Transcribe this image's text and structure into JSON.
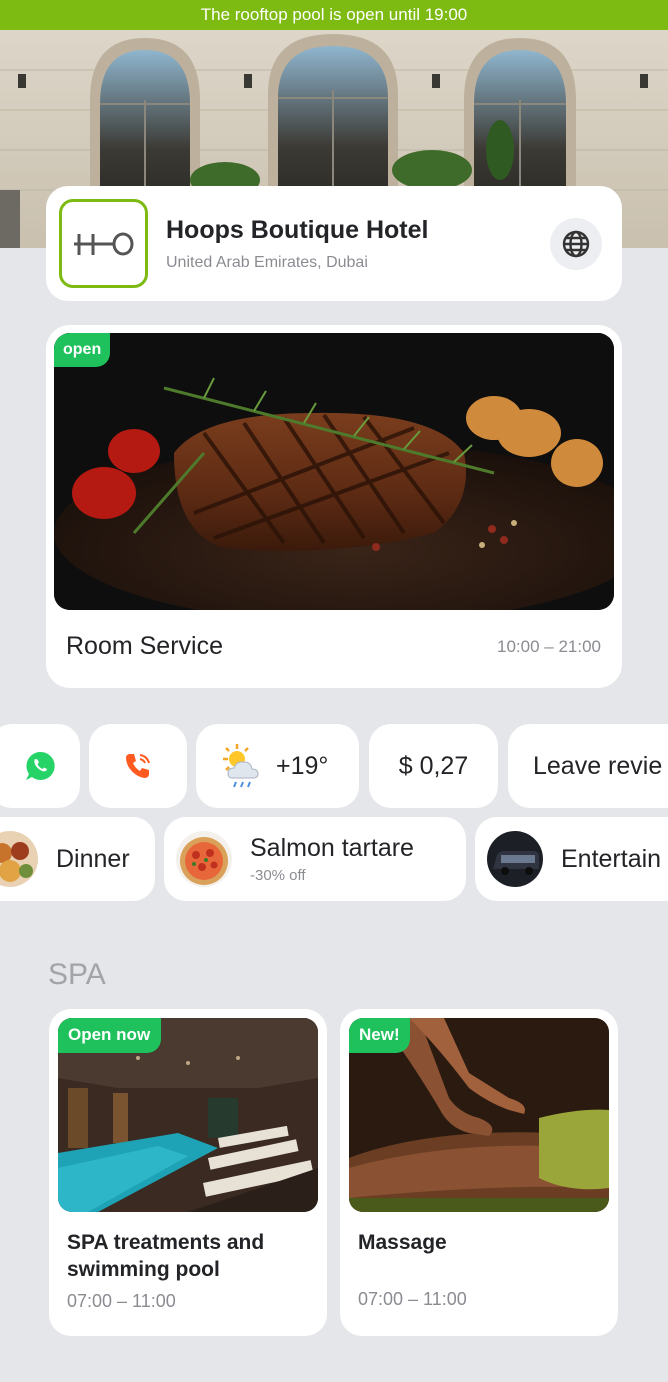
{
  "banner": {
    "text": "The rooftop pool is open until 19:00"
  },
  "hotel": {
    "logo_text": "H–O",
    "name": "Hoops Boutique Hotel",
    "location": "United Arab Emirates, Dubai"
  },
  "room_service": {
    "badge": "open",
    "title": "Room Service",
    "hours": "10:00 – 21:00"
  },
  "quick_actions": {
    "weather": "+19°",
    "rate": "$ 0,27",
    "review": "Leave revie"
  },
  "offers": [
    {
      "label": "Dinner"
    },
    {
      "label": "Salmon tartare",
      "sub": "-30% off"
    },
    {
      "label": "Entertain"
    }
  ],
  "spa": {
    "title": "SPA",
    "cards": [
      {
        "badge": "Open now",
        "name": "SPA treatments and swimming pool",
        "hours": "07:00 – 11:00"
      },
      {
        "badge": "New!",
        "name": "Massage",
        "hours": "07:00 – 11:00"
      }
    ]
  },
  "colors": {
    "brand_green": "#7dba12",
    "badge_green": "#1fc15c",
    "whatsapp": "#25d366",
    "phone_orange": "#ff5a1f",
    "background": "#e4e6ea"
  },
  "icons": [
    "globe-icon",
    "whatsapp-icon",
    "phone-icon",
    "weather-sun-cloud-icon"
  ]
}
